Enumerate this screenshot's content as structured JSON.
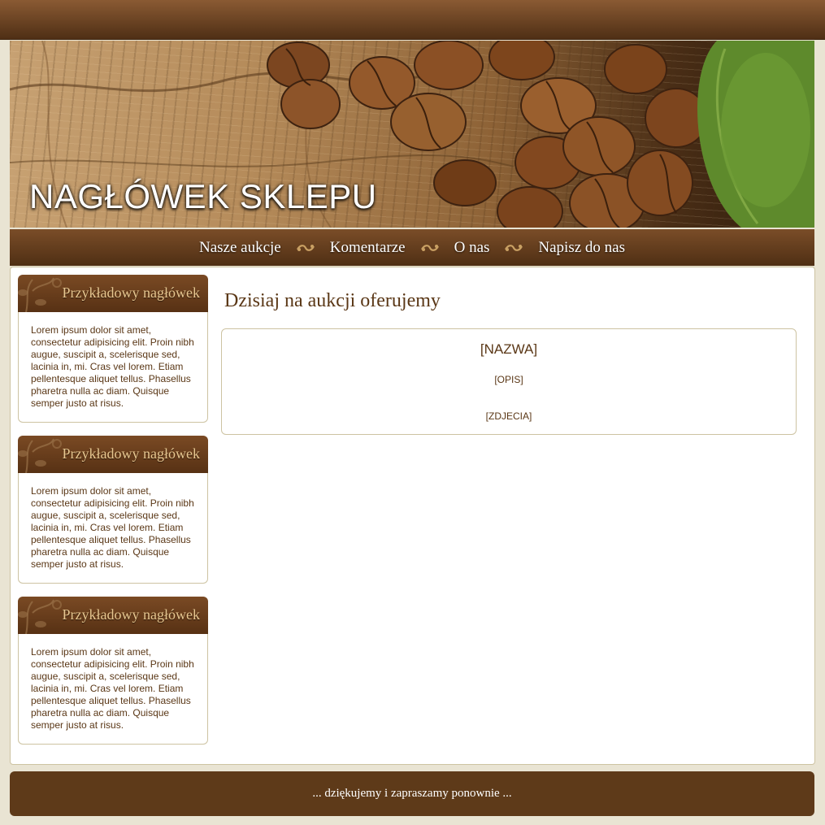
{
  "header": {
    "banner_title": "NAGŁÓWEK SKLEPU"
  },
  "nav": {
    "items": [
      {
        "label": "Nasze aukcje"
      },
      {
        "label": "Komentarze"
      },
      {
        "label": "O nas"
      },
      {
        "label": "Napisz do nas"
      }
    ],
    "separator_icon": "swirl-ornament-icon"
  },
  "sidebar": {
    "boxes": [
      {
        "title": "Przykładowy nagłówek",
        "text": "Lorem ipsum dolor sit amet, consectetur adipisicing elit. Proin nibh augue, suscipit a, scelerisque sed, lacinia in, mi. Cras vel lorem. Etiam pellentesque aliquet tellus. Phasellus pharetra nulla ac diam. Quisque semper justo at risus."
      },
      {
        "title": "Przykładowy nagłówek",
        "text": "Lorem ipsum dolor sit amet, consectetur adipisicing elit. Proin nibh augue, suscipit a, scelerisque sed, lacinia in, mi. Cras vel lorem. Etiam pellentesque aliquet tellus. Phasellus pharetra nulla ac diam. Quisque semper justo at risus."
      },
      {
        "title": "Przykładowy nagłówek",
        "text": "Lorem ipsum dolor sit amet, consectetur adipisicing elit. Proin nibh augue, suscipit a, scelerisque sed, lacinia in, mi. Cras vel lorem. Etiam pellentesque aliquet tellus. Phasellus pharetra nulla ac diam. Quisque semper justo at risus."
      }
    ]
  },
  "main": {
    "title": "Dzisiaj na aukcji oferujemy",
    "product": {
      "name": "[NAZWA]",
      "description": "[OPIS]",
      "photos": "[ZDJECIA]"
    }
  },
  "footer": {
    "text": "... dziękujemy i zapraszamy ponownie ..."
  },
  "colors": {
    "brown_dark": "#4f2f15",
    "brown_mid": "#7a4d28",
    "text_brown": "#5a3716",
    "gold": "#e8c790",
    "page_bg": "#e9e4d3",
    "border": "#cdc3a2"
  }
}
